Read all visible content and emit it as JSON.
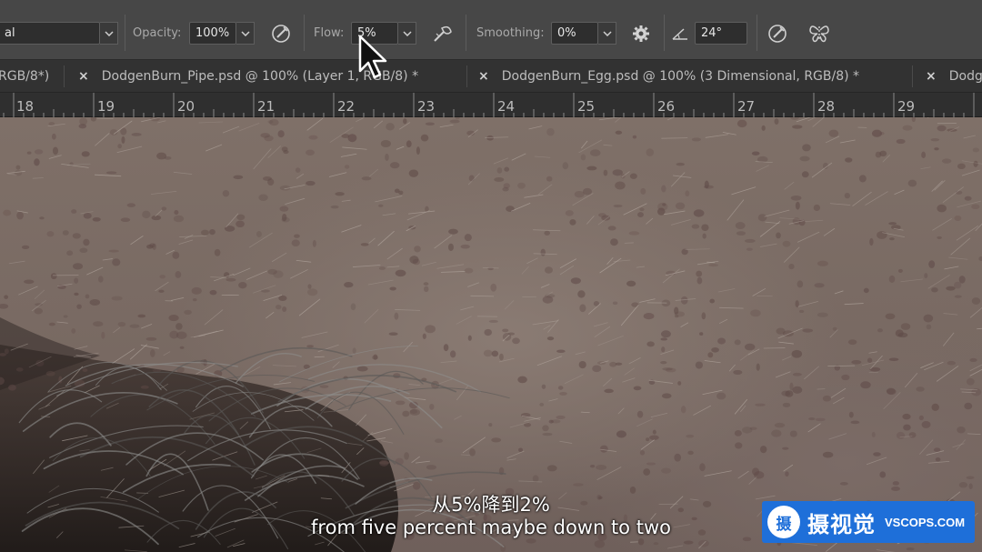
{
  "options_bar": {
    "mode_value": "al",
    "opacity_label": "Opacity:",
    "opacity_value": "100%",
    "flow_label": "Flow:",
    "flow_value": "5%",
    "smoothing_label": "Smoothing:",
    "smoothing_value": "0%",
    "angle_value": "24°",
    "icons": [
      "pressure-opacity-icon",
      "airbrush-icon",
      "gear-icon",
      "angle-icon",
      "pressure-size-icon",
      "symmetry-butterfly-icon"
    ]
  },
  "tabs": [
    {
      "label": "RGB/8*)"
    },
    {
      "close": "×",
      "label": "DodgenBurn_Pipe.psd @ 100% (Layer 1, RGB/8) *"
    },
    {
      "close": "×",
      "label": "DodgenBurn_Egg.psd @ 100% (3 Dimensional, RGB/8) *"
    },
    {
      "close": "×",
      "label": "Dodg"
    }
  ],
  "ruler": {
    "labels": [
      "18",
      "19",
      "20",
      "21",
      "22",
      "23",
      "24",
      "25",
      "26",
      "27",
      "28",
      "29"
    ]
  },
  "subtitles": {
    "chinese": "从5%降到2%",
    "english": "from five percent maybe down to two"
  },
  "watermark": {
    "seal": "摄",
    "chinese": "摄视觉",
    "english": "VSCOPS.COM",
    "color": "#1e6fd9"
  },
  "colors": {
    "toolbar_bg": "#474747",
    "tabs_bg": "#323232",
    "ruler_bg": "#2f2f2f",
    "skin_tone": "#7f7068"
  }
}
